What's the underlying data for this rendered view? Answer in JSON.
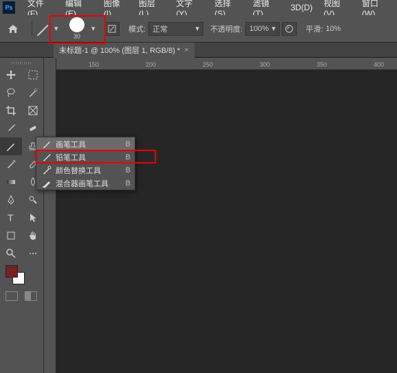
{
  "menu": [
    "文件(F)",
    "编辑(E)",
    "图像(I)",
    "图层(L)",
    "文字(Y)",
    "选择(S)",
    "滤镜(T)",
    "3D(D)",
    "视图(V)",
    "窗口(W)"
  ],
  "options": {
    "brush_size": "30",
    "mode_label": "模式:",
    "mode_value": "正常",
    "opacity_label": "不透明度:",
    "opacity_value": "100%",
    "smooth_label": "平滑:",
    "smooth_value": "10%"
  },
  "tab": {
    "title": "未标题-1 @ 100% (图层 1, RGB/8) *"
  },
  "ruler": {
    "t150": "150",
    "t200": "200",
    "t250": "250",
    "t300": "300",
    "t350": "350",
    "t400": "400"
  },
  "context": {
    "items": [
      {
        "label": "画笔工具",
        "key": "B"
      },
      {
        "label": "铅笔工具",
        "key": "B"
      },
      {
        "label": "颜色替换工具",
        "key": "B"
      },
      {
        "label": "混合器画笔工具",
        "key": "B"
      }
    ]
  },
  "swatches": {
    "fg": "#7a1f1f",
    "bg": "#ffffff"
  }
}
